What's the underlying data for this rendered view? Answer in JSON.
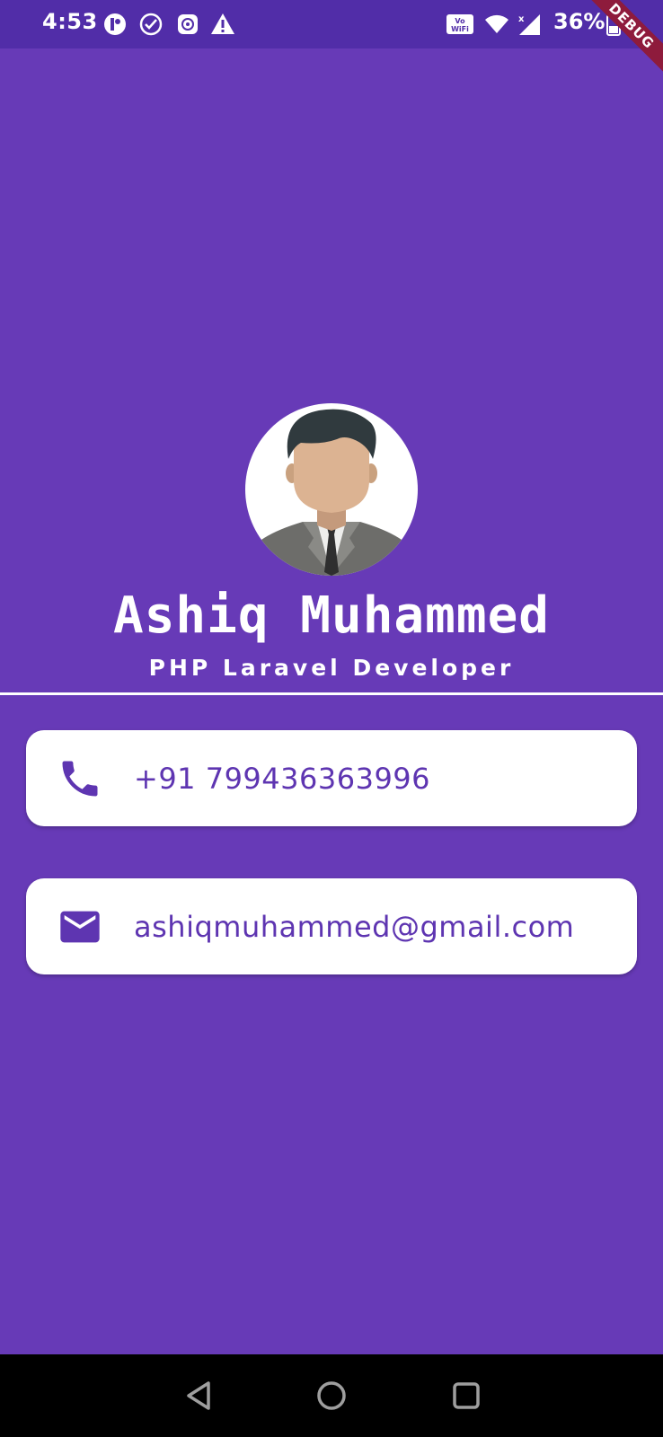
{
  "status_bar": {
    "time": "4:53",
    "battery_text": "36%",
    "icons": [
      "vpn-icon",
      "check-circle-icon",
      "app-icon",
      "warning-icon",
      "vowifi-icon",
      "wifi-icon",
      "signal-icon",
      "battery-icon"
    ]
  },
  "debug_banner": "DEBUG",
  "profile": {
    "name": "Ashiq Muhammed",
    "role": "PHP Laravel Developer"
  },
  "contacts": {
    "phone": {
      "icon": "phone-icon",
      "value": "+91 799436363996"
    },
    "email": {
      "icon": "mail-icon",
      "value": "ashiqmuhammed@gmail.com"
    }
  },
  "colors": {
    "background": "#673ab7",
    "status_bar": "#512da8",
    "accent_text": "#5e35b1",
    "card": "#ffffff"
  },
  "nav_bar": {
    "buttons": [
      "back-icon",
      "home-icon",
      "recents-icon"
    ]
  }
}
